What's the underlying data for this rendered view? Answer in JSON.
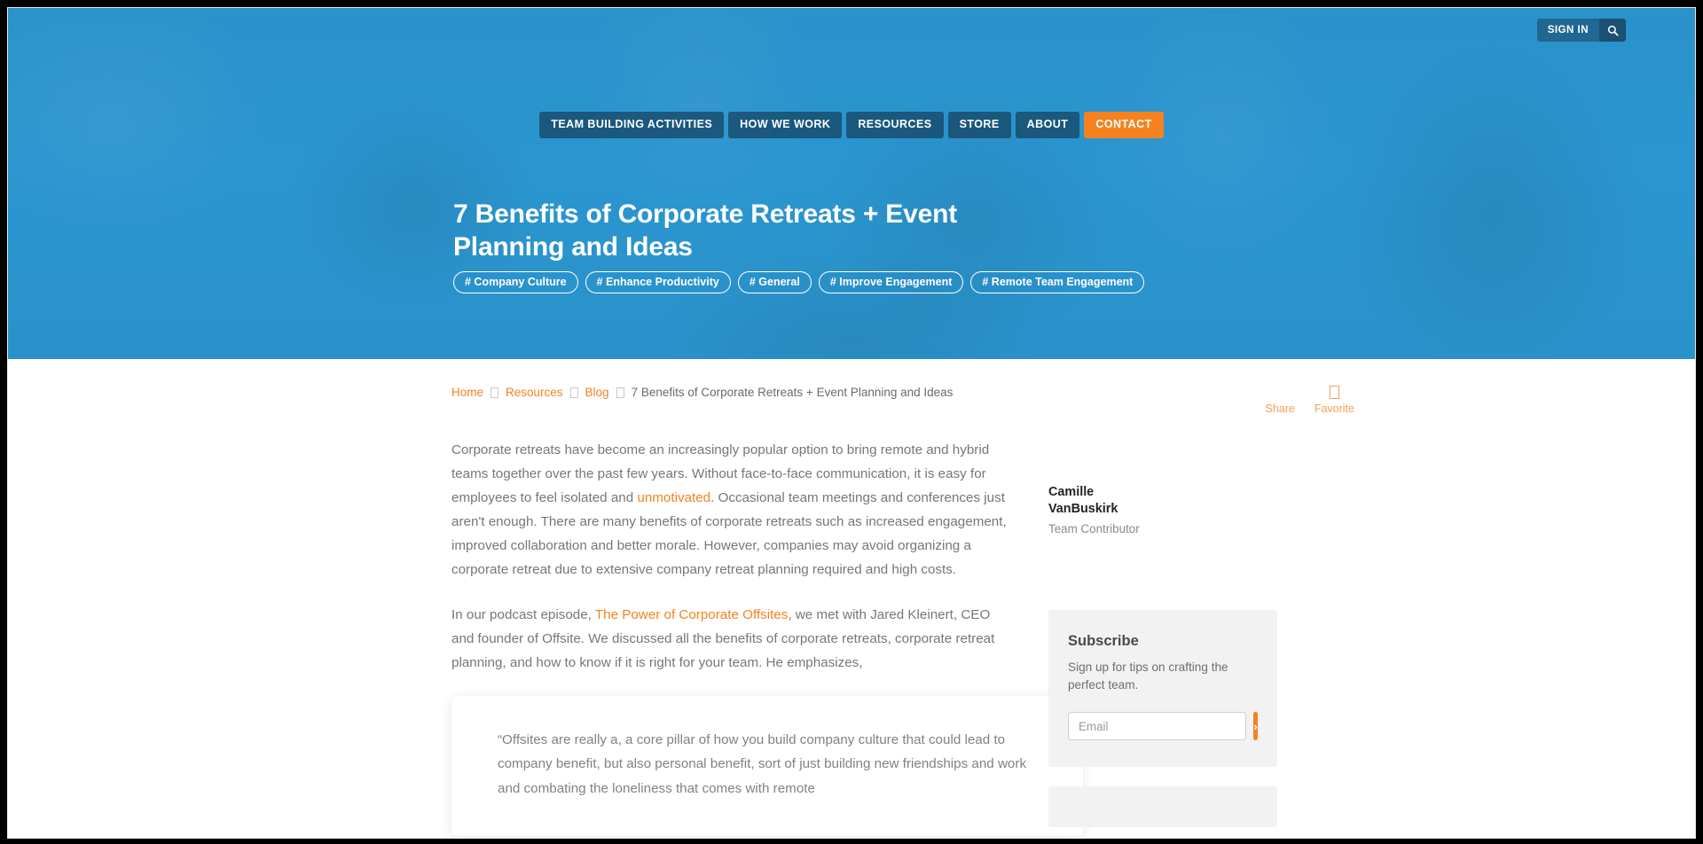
{
  "topbar": {
    "signin_label": "SIGN IN",
    "search_icon": "search-icon"
  },
  "nav": {
    "items": [
      {
        "label": "TEAM BUILDING ACTIVITIES",
        "cta": false
      },
      {
        "label": "HOW WE WORK",
        "cta": false
      },
      {
        "label": "RESOURCES",
        "cta": false
      },
      {
        "label": "STORE",
        "cta": false
      },
      {
        "label": "ABOUT",
        "cta": false
      },
      {
        "label": "CONTACT",
        "cta": true
      }
    ]
  },
  "hero": {
    "title": "7 Benefits of Corporate Retreats + Event Planning and Ideas",
    "tags": [
      "# Company Culture",
      "# Enhance Productivity",
      "# General",
      "# Improve Engagement",
      "# Remote Team Engagement"
    ]
  },
  "breadcrumb": {
    "home": "Home",
    "resources": "Resources",
    "blog": "Blog",
    "current": "7 Benefits of Corporate Retreats + Event Planning and Ideas"
  },
  "actions": {
    "share_label": "Share",
    "favorite_label": "Favorite",
    "share_icon": "share-icon",
    "favorite_icon": "bookmark-icon"
  },
  "article": {
    "paragraph_1_a": "Corporate retreats have become an increasingly popular option to bring remote and hybrid teams together over the past few years. Without face-to-face communication, it is easy for employees to feel isolated and ",
    "paragraph_1_link": "unmotivated",
    "paragraph_1_b": ". Occasional team meetings and conferences just aren't enough. There are many benefits of corporate retreats such as increased engagement, improved collaboration and better morale. However, companies may avoid organizing a corporate retreat due to extensive company retreat planning required and high costs.",
    "paragraph_2_a": "In our podcast episode, ",
    "paragraph_2_link": "The Power of Corporate Offsites",
    "paragraph_2_b": ", we met with Jared Kleinert, CEO and founder of Offsite. We discussed all the benefits of corporate retreats, corporate retreat planning, and how to know if it is right for your team. He emphasizes,",
    "quote": "“Offsites are really a, a core pillar of how you build company culture that could lead to company benefit, but also personal benefit, sort of just building new friendships and work and combating the loneliness that comes with remote"
  },
  "author": {
    "name": "Camille VanBuskirk",
    "role": "Team Contributor"
  },
  "subscribe": {
    "title": "Subscribe",
    "description": "Sign up for tips on crafting the perfect team.",
    "email_placeholder": "Email",
    "email_value": "",
    "submit_label": "›"
  },
  "colors": {
    "accent_orange": "#f5821f",
    "hero_blue": "#2a93cd",
    "nav_dark": "#10344c"
  }
}
